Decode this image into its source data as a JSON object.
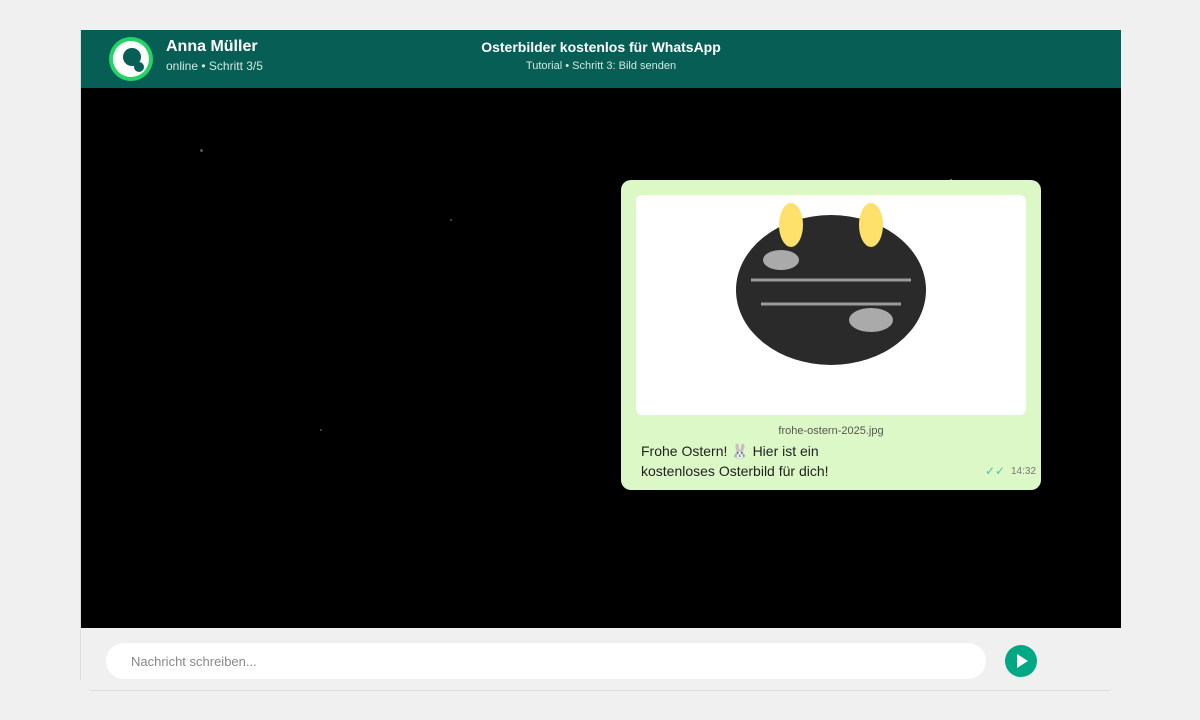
{
  "header": {
    "contact_name": "Anna Müller",
    "contact_status": "online • Schritt 3/5",
    "title": "Osterbilder kostenlos für WhatsApp",
    "subtitle": "Tutorial • Schritt 3: Bild senden"
  },
  "message": {
    "filename": "frohe-ostern-2025.jpg",
    "caption_line1": "Frohe Ostern! 🐰 Hier ist ein",
    "caption_line2": "kostenloses Osterbild für dich!",
    "ticks": "✓✓",
    "time": "14:32"
  },
  "composer": {
    "placeholder": "Nachricht schreiben..."
  },
  "colors": {
    "header": "#075e54",
    "bubble": "#dcf8c6",
    "accent": "#00a884",
    "ears": "#fde16b"
  },
  "icons": {
    "avatar": "user-avatar-icon",
    "send": "send-icon",
    "image": "easter-egg-image"
  }
}
